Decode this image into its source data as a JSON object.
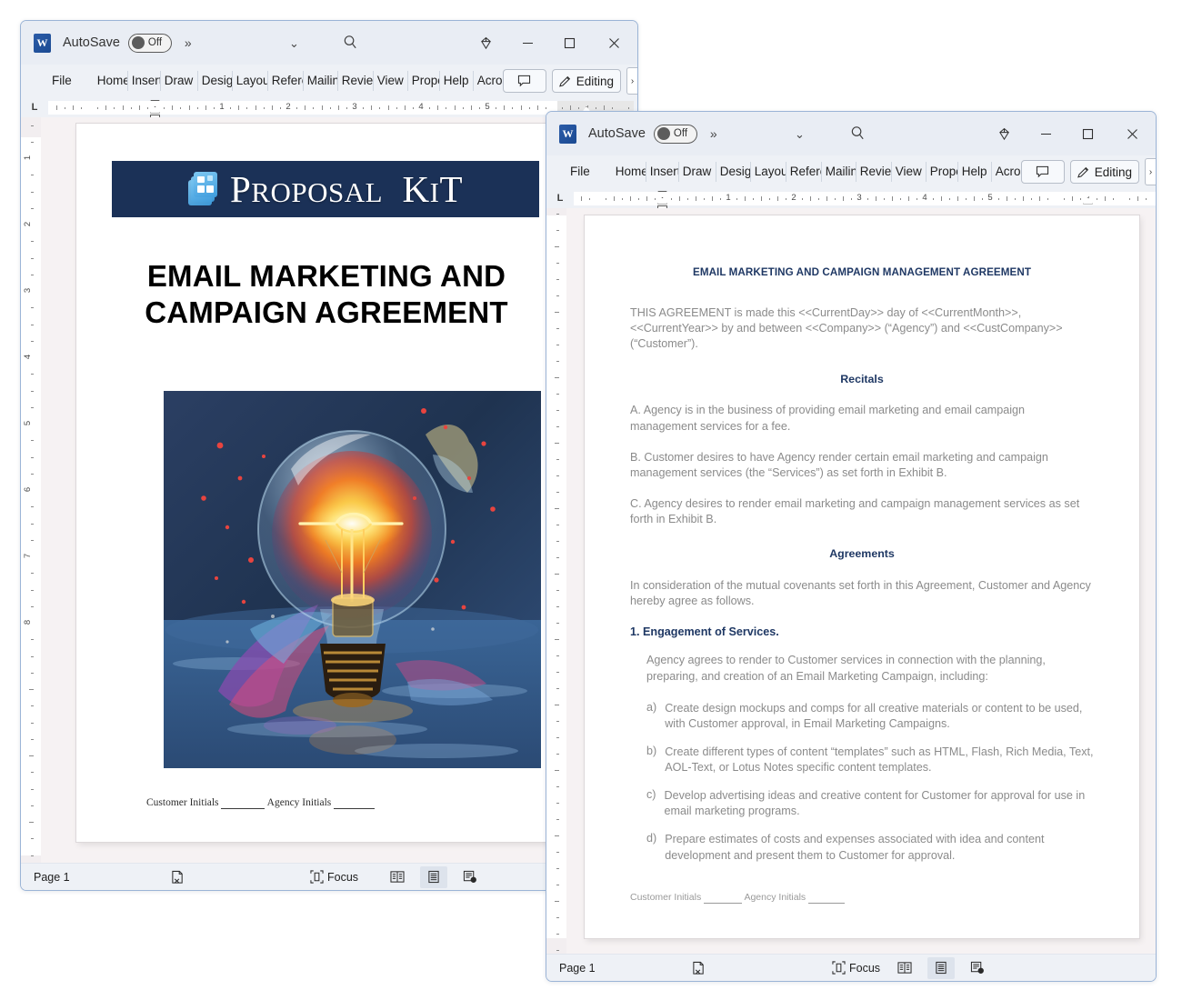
{
  "window1": {
    "app_icon": "W",
    "autosave_label": "AutoSave",
    "autosave_state": "Off",
    "overflow_icon": "more-commands-chevrons",
    "quick_access_chevron": "chevron-down-icon",
    "search_icon": "search-icon",
    "diamond_icon": "diamond-icon",
    "minimize": "minimize-icon",
    "maximize": "maximize-icon",
    "close": "close-icon",
    "tabs": [
      "File",
      "Home",
      "Insert",
      "Draw",
      "Design",
      "Layout",
      "References",
      "Mailings",
      "Review",
      "View",
      "Proposal Kit",
      "Help",
      "Acrobat"
    ],
    "comment_button": "comments-icon",
    "editing_label": "Editing",
    "editing_icon": "pencil-icon",
    "ruler_corner": "L",
    "ruler_numbers": [
      "1",
      "2",
      "3",
      "4",
      "5"
    ],
    "vruler_numbers": [
      "1",
      "2",
      "3",
      "4",
      "5",
      "6",
      "7",
      "8"
    ],
    "status": {
      "page": "Page 1",
      "proofing_icon": "proofing-errors-icon",
      "focus_label": "Focus",
      "focus_icon": "focus-icon",
      "view_read": "read-mode-icon",
      "view_print": "print-layout-icon",
      "view_web": "web-layout-icon"
    },
    "document": {
      "banner_brand": "Proposal Kit",
      "banner_brand_upper": "PROPOSAL KIT",
      "banner_color": "#1b3157",
      "logo_icon": "proposal-kit-logo",
      "title_line1": "EMAIL MARKETING AND",
      "title_line2": "CAMPAIGN AGREEMENT",
      "image_alt": "glowing-lightbulb-splash-artwork",
      "footer_customer": "Customer Initials",
      "footer_agency": "Agency Initials"
    }
  },
  "window2": {
    "app_icon": "W",
    "autosave_label": "AutoSave",
    "autosave_state": "Off",
    "overflow_icon": "more-commands-chevrons",
    "quick_access_chevron": "chevron-down-icon",
    "search_icon": "search-icon",
    "diamond_icon": "diamond-icon",
    "minimize": "minimize-icon",
    "maximize": "maximize-icon",
    "close": "close-icon",
    "tabs": [
      "File",
      "Home",
      "Insert",
      "Draw",
      "Design",
      "Layout",
      "References",
      "Mailings",
      "Review",
      "View",
      "Proposal Kit",
      "Help",
      "Acrobat"
    ],
    "comment_button": "comments-icon",
    "editing_label": "Editing",
    "editing_icon": "pencil-icon",
    "ruler_corner": "L",
    "ruler_numbers": [
      "1",
      "2",
      "3",
      "4",
      "5"
    ],
    "status": {
      "page": "Page 1",
      "proofing_icon": "proofing-errors-icon",
      "focus_label": "Focus",
      "focus_icon": "focus-icon",
      "view_read": "read-mode-icon",
      "view_print": "print-layout-icon",
      "view_web": "web-layout-icon"
    },
    "document": {
      "heading": "EMAIL MARKETING AND CAMPAIGN MANAGEMENT AGREEMENT",
      "intro": "THIS AGREEMENT is made this <<CurrentDay>> day of <<CurrentMonth>>, <<CurrentYear>> by and between <<Company>> (“Agency”) and <<CustCompany>> (“Customer”).",
      "recitals_heading": "Recitals",
      "recital_a": "A. Agency is in the business of providing email marketing and email campaign management services for a fee.",
      "recital_b": "B. Customer desires to have Agency render certain email marketing and campaign management services (the “Services”) as set forth in Exhibit B.",
      "recital_c": "C. Agency desires to render email marketing and campaign management services as set forth in Exhibit B.",
      "agreements_heading": "Agreements",
      "consideration": "In consideration of the mutual covenants set forth in this Agreement, Customer and Agency hereby agree as follows.",
      "section1_heading": "1. Engagement of Services.",
      "section1_body": "Agency agrees to render to Customer services in connection with the planning, preparing, and creation of an Email Marketing Campaign, including:",
      "list": [
        {
          "marker": "a)",
          "text": "Create design mockups and comps for all creative materials or content to be used, with Customer approval, in Email Marketing Campaigns."
        },
        {
          "marker": "b)",
          "text": "Create different types of content “templates” such as HTML, Flash, Rich Media, Text, AOL-Text, or Lotus Notes specific content templates."
        },
        {
          "marker": "c)",
          "text": "Develop advertising ideas and creative content for Customer for approval for use in email marketing programs."
        },
        {
          "marker": "d)",
          "text": "Prepare estimates of costs and expenses associated with idea and content development and present them to Customer for approval."
        }
      ],
      "footer_customer": "Customer Initials",
      "footer_agency": "Agency Initials"
    }
  }
}
